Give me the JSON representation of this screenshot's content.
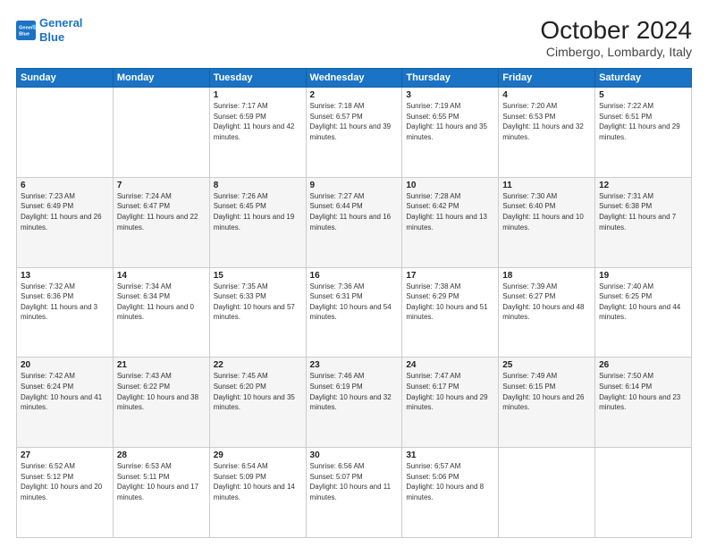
{
  "logo": {
    "line1": "General",
    "line2": "Blue"
  },
  "title": "October 2024",
  "location": "Cimbergo, Lombardy, Italy",
  "days_header": [
    "Sunday",
    "Monday",
    "Tuesday",
    "Wednesday",
    "Thursday",
    "Friday",
    "Saturday"
  ],
  "weeks": [
    [
      null,
      null,
      {
        "num": "1",
        "sunrise": "Sunrise: 7:17 AM",
        "sunset": "Sunset: 6:59 PM",
        "daylight": "Daylight: 11 hours and 42 minutes."
      },
      {
        "num": "2",
        "sunrise": "Sunrise: 7:18 AM",
        "sunset": "Sunset: 6:57 PM",
        "daylight": "Daylight: 11 hours and 39 minutes."
      },
      {
        "num": "3",
        "sunrise": "Sunrise: 7:19 AM",
        "sunset": "Sunset: 6:55 PM",
        "daylight": "Daylight: 11 hours and 35 minutes."
      },
      {
        "num": "4",
        "sunrise": "Sunrise: 7:20 AM",
        "sunset": "Sunset: 6:53 PM",
        "daylight": "Daylight: 11 hours and 32 minutes."
      },
      {
        "num": "5",
        "sunrise": "Sunrise: 7:22 AM",
        "sunset": "Sunset: 6:51 PM",
        "daylight": "Daylight: 11 hours and 29 minutes."
      }
    ],
    [
      {
        "num": "6",
        "sunrise": "Sunrise: 7:23 AM",
        "sunset": "Sunset: 6:49 PM",
        "daylight": "Daylight: 11 hours and 26 minutes."
      },
      {
        "num": "7",
        "sunrise": "Sunrise: 7:24 AM",
        "sunset": "Sunset: 6:47 PM",
        "daylight": "Daylight: 11 hours and 22 minutes."
      },
      {
        "num": "8",
        "sunrise": "Sunrise: 7:26 AM",
        "sunset": "Sunset: 6:45 PM",
        "daylight": "Daylight: 11 hours and 19 minutes."
      },
      {
        "num": "9",
        "sunrise": "Sunrise: 7:27 AM",
        "sunset": "Sunset: 6:44 PM",
        "daylight": "Daylight: 11 hours and 16 minutes."
      },
      {
        "num": "10",
        "sunrise": "Sunrise: 7:28 AM",
        "sunset": "Sunset: 6:42 PM",
        "daylight": "Daylight: 11 hours and 13 minutes."
      },
      {
        "num": "11",
        "sunrise": "Sunrise: 7:30 AM",
        "sunset": "Sunset: 6:40 PM",
        "daylight": "Daylight: 11 hours and 10 minutes."
      },
      {
        "num": "12",
        "sunrise": "Sunrise: 7:31 AM",
        "sunset": "Sunset: 6:38 PM",
        "daylight": "Daylight: 11 hours and 7 minutes."
      }
    ],
    [
      {
        "num": "13",
        "sunrise": "Sunrise: 7:32 AM",
        "sunset": "Sunset: 6:36 PM",
        "daylight": "Daylight: 11 hours and 3 minutes."
      },
      {
        "num": "14",
        "sunrise": "Sunrise: 7:34 AM",
        "sunset": "Sunset: 6:34 PM",
        "daylight": "Daylight: 11 hours and 0 minutes."
      },
      {
        "num": "15",
        "sunrise": "Sunrise: 7:35 AM",
        "sunset": "Sunset: 6:33 PM",
        "daylight": "Daylight: 10 hours and 57 minutes."
      },
      {
        "num": "16",
        "sunrise": "Sunrise: 7:36 AM",
        "sunset": "Sunset: 6:31 PM",
        "daylight": "Daylight: 10 hours and 54 minutes."
      },
      {
        "num": "17",
        "sunrise": "Sunrise: 7:38 AM",
        "sunset": "Sunset: 6:29 PM",
        "daylight": "Daylight: 10 hours and 51 minutes."
      },
      {
        "num": "18",
        "sunrise": "Sunrise: 7:39 AM",
        "sunset": "Sunset: 6:27 PM",
        "daylight": "Daylight: 10 hours and 48 minutes."
      },
      {
        "num": "19",
        "sunrise": "Sunrise: 7:40 AM",
        "sunset": "Sunset: 6:25 PM",
        "daylight": "Daylight: 10 hours and 44 minutes."
      }
    ],
    [
      {
        "num": "20",
        "sunrise": "Sunrise: 7:42 AM",
        "sunset": "Sunset: 6:24 PM",
        "daylight": "Daylight: 10 hours and 41 minutes."
      },
      {
        "num": "21",
        "sunrise": "Sunrise: 7:43 AM",
        "sunset": "Sunset: 6:22 PM",
        "daylight": "Daylight: 10 hours and 38 minutes."
      },
      {
        "num": "22",
        "sunrise": "Sunrise: 7:45 AM",
        "sunset": "Sunset: 6:20 PM",
        "daylight": "Daylight: 10 hours and 35 minutes."
      },
      {
        "num": "23",
        "sunrise": "Sunrise: 7:46 AM",
        "sunset": "Sunset: 6:19 PM",
        "daylight": "Daylight: 10 hours and 32 minutes."
      },
      {
        "num": "24",
        "sunrise": "Sunrise: 7:47 AM",
        "sunset": "Sunset: 6:17 PM",
        "daylight": "Daylight: 10 hours and 29 minutes."
      },
      {
        "num": "25",
        "sunrise": "Sunrise: 7:49 AM",
        "sunset": "Sunset: 6:15 PM",
        "daylight": "Daylight: 10 hours and 26 minutes."
      },
      {
        "num": "26",
        "sunrise": "Sunrise: 7:50 AM",
        "sunset": "Sunset: 6:14 PM",
        "daylight": "Daylight: 10 hours and 23 minutes."
      }
    ],
    [
      {
        "num": "27",
        "sunrise": "Sunrise: 6:52 AM",
        "sunset": "Sunset: 5:12 PM",
        "daylight": "Daylight: 10 hours and 20 minutes."
      },
      {
        "num": "28",
        "sunrise": "Sunrise: 6:53 AM",
        "sunset": "Sunset: 5:11 PM",
        "daylight": "Daylight: 10 hours and 17 minutes."
      },
      {
        "num": "29",
        "sunrise": "Sunrise: 6:54 AM",
        "sunset": "Sunset: 5:09 PM",
        "daylight": "Daylight: 10 hours and 14 minutes."
      },
      {
        "num": "30",
        "sunrise": "Sunrise: 6:56 AM",
        "sunset": "Sunset: 5:07 PM",
        "daylight": "Daylight: 10 hours and 11 minutes."
      },
      {
        "num": "31",
        "sunrise": "Sunrise: 6:57 AM",
        "sunset": "Sunset: 5:06 PM",
        "daylight": "Daylight: 10 hours and 8 minutes."
      },
      null,
      null
    ]
  ]
}
